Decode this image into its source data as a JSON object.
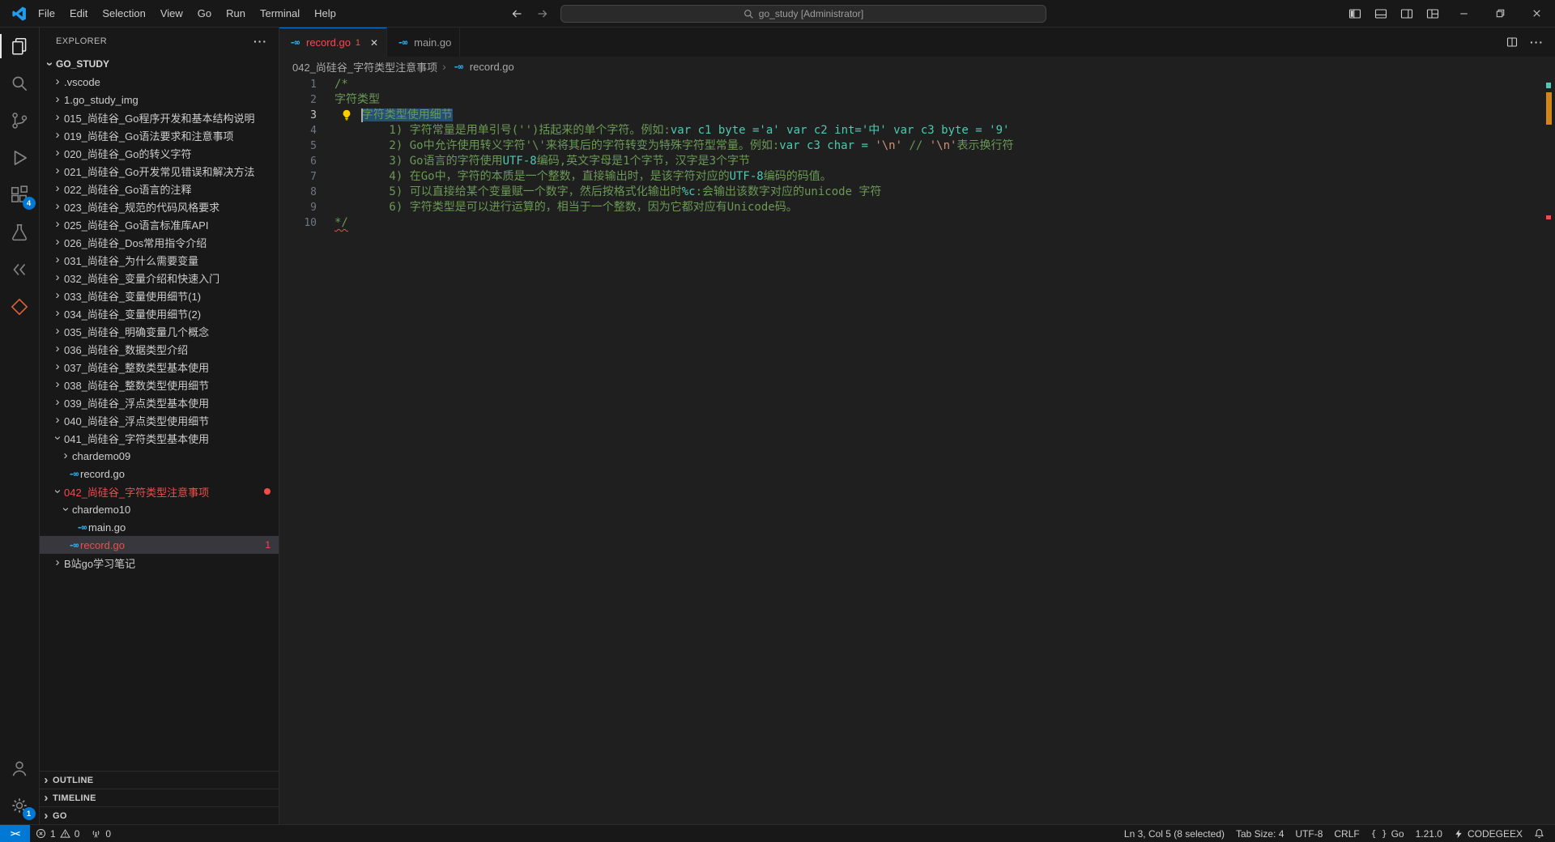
{
  "window": {
    "search_text": "go_study [Administrator]"
  },
  "menubar": {
    "items": [
      "File",
      "Edit",
      "Selection",
      "View",
      "Go",
      "Run",
      "Terminal",
      "Help"
    ]
  },
  "activity_bar": {
    "extensions_badge": "4",
    "manage_badge": "1"
  },
  "icons": {
    "chevron": "›",
    "go_file": "-∞",
    "more_horizontal": "···",
    "close": "✕",
    "remote": "><"
  },
  "explorer": {
    "header": "EXPLORER",
    "root": "GO_STUDY",
    "items": [
      {
        "label": ".vscode",
        "level": 1,
        "kind": "folder"
      },
      {
        "label": "1.go_study_img",
        "level": 1,
        "kind": "folder"
      },
      {
        "label": "015_尚硅谷_Go程序开发和基本结构说明",
        "level": 1,
        "kind": "folder"
      },
      {
        "label": "019_尚硅谷_Go语法要求和注意事项",
        "level": 1,
        "kind": "folder"
      },
      {
        "label": "020_尚硅谷_Go的转义字符",
        "level": 1,
        "kind": "folder"
      },
      {
        "label": "021_尚硅谷_Go开发常见错误和解决方法",
        "level": 1,
        "kind": "folder"
      },
      {
        "label": "022_尚硅谷_Go语言的注释",
        "level": 1,
        "kind": "folder"
      },
      {
        "label": "023_尚硅谷_规范的代码风格要求",
        "level": 1,
        "kind": "folder"
      },
      {
        "label": "025_尚硅谷_Go语言标准库API",
        "level": 1,
        "kind": "folder"
      },
      {
        "label": "026_尚硅谷_Dos常用指令介绍",
        "level": 1,
        "kind": "folder"
      },
      {
        "label": "031_尚硅谷_为什么需要变量",
        "level": 1,
        "kind": "folder"
      },
      {
        "label": "032_尚硅谷_变量介绍和快速入门",
        "level": 1,
        "kind": "folder"
      },
      {
        "label": "033_尚硅谷_变量使用细节(1)",
        "level": 1,
        "kind": "folder"
      },
      {
        "label": "034_尚硅谷_变量使用细节(2)",
        "level": 1,
        "kind": "folder"
      },
      {
        "label": "035_尚硅谷_明确变量几个概念",
        "level": 1,
        "kind": "folder"
      },
      {
        "label": "036_尚硅谷_数据类型介绍",
        "level": 1,
        "kind": "folder"
      },
      {
        "label": "037_尚硅谷_整数类型基本使用",
        "level": 1,
        "kind": "folder"
      },
      {
        "label": "038_尚硅谷_整数类型使用细节",
        "level": 1,
        "kind": "folder"
      },
      {
        "label": "039_尚硅谷_浮点类型基本使用",
        "level": 1,
        "kind": "folder"
      },
      {
        "label": "040_尚硅谷_浮点类型使用细节",
        "level": 1,
        "kind": "folder"
      },
      {
        "label": "041_尚硅谷_字符类型基本使用",
        "level": 1,
        "kind": "folder",
        "expanded": true
      },
      {
        "label": "chardemo09",
        "level": 2,
        "kind": "folder"
      },
      {
        "label": "record.go",
        "level": 2,
        "kind": "file"
      },
      {
        "label": "042_尚硅谷_字符类型注意事项",
        "level": 1,
        "kind": "folder",
        "expanded": true,
        "error": true,
        "dot": true
      },
      {
        "label": "chardemo10",
        "level": 2,
        "kind": "folder",
        "expanded": true
      },
      {
        "label": "main.go",
        "level": 3,
        "kind": "file"
      },
      {
        "label": "record.go",
        "level": 2,
        "kind": "file",
        "error": true,
        "selected": true,
        "badge": "1"
      },
      {
        "label": "B站go学习笔记",
        "level": 1,
        "kind": "folder"
      }
    ],
    "bottom_sections": [
      "OUTLINE",
      "TIMELINE",
      "GO"
    ]
  },
  "editor_tabs": [
    {
      "label": "record.go",
      "error_badge": "1"
    },
    {
      "label": "main.go"
    }
  ],
  "breadcrumb": {
    "folder": "042_尚硅谷_字符类型注意事项",
    "file": "record.go"
  },
  "editor": {
    "lines": [
      {
        "num": "1",
        "segments": [
          {
            "t": "/*",
            "s": "c"
          }
        ]
      },
      {
        "num": "2",
        "segments": [
          {
            "t": "字符类型",
            "s": "c"
          }
        ]
      },
      {
        "num": "3",
        "active": true,
        "lightbulb": true,
        "caret": true,
        "segments": [
          {
            "t": "    ",
            "s": "c"
          },
          {
            "t": "字符类型使用细节",
            "s": "c sel"
          }
        ]
      },
      {
        "num": "4",
        "segments": [
          {
            "t": "        1) 字符常量是用单引号('')括起来的单个字符。例如:",
            "s": "c"
          },
          {
            "t": "var c1 byte ='a' var c2 int='中' var c3 byte = '9'",
            "s": "t"
          }
        ]
      },
      {
        "num": "5",
        "segments": [
          {
            "t": "        2) Go中允许使用转义字符'\\'来将其后的字符转变为特殊字符型常量。例如:",
            "s": "c"
          },
          {
            "t": "var c3 char = ",
            "s": "t"
          },
          {
            "t": "'\\n'",
            "s": "o"
          },
          {
            "t": " // ",
            "s": "c"
          },
          {
            "t": "'\\n'",
            "s": "o"
          },
          {
            "t": "表示换行符",
            "s": "c"
          }
        ]
      },
      {
        "num": "6",
        "segments": [
          {
            "t": "        3) Go语言的字符使用",
            "s": "c"
          },
          {
            "t": "UTF-8",
            "s": "t"
          },
          {
            "t": "编码,英文字母是1个字节，汉字是3个字节",
            "s": "c"
          }
        ]
      },
      {
        "num": "7",
        "segments": [
          {
            "t": "        4) 在Go中，字符的本质是一个整数，直接输出时，是该字符对应的",
            "s": "c"
          },
          {
            "t": "UTF-8",
            "s": "t"
          },
          {
            "t": "编码的码值。",
            "s": "c"
          }
        ]
      },
      {
        "num": "8",
        "segments": [
          {
            "t": "        5) 可以直接给某个变量赋一个数字，然后按格式化输出时",
            "s": "c"
          },
          {
            "t": "%c",
            "s": "t"
          },
          {
            "t": ":会输出该数字对应的unicode 字符",
            "s": "c"
          }
        ]
      },
      {
        "num": "9",
        "segments": [
          {
            "t": "        6) 字符类型是可以进行运算的，相当于一个整数，因为它都对应有Unicode码。",
            "s": "c"
          }
        ]
      },
      {
        "num": "10",
        "segments": [
          {
            "t": "*/",
            "s": "c err"
          }
        ]
      }
    ]
  },
  "status_bar": {
    "errors": "1",
    "warnings": "0",
    "ports": "0",
    "selection": "Ln 3, Col 5 (8 selected)",
    "tab_size": "Tab Size: 4",
    "encoding": "UTF-8",
    "eol": "CRLF",
    "language_icon": "{ }",
    "language": "Go",
    "go_version": "1.21.0",
    "assistant": "CODEGEEX"
  }
}
